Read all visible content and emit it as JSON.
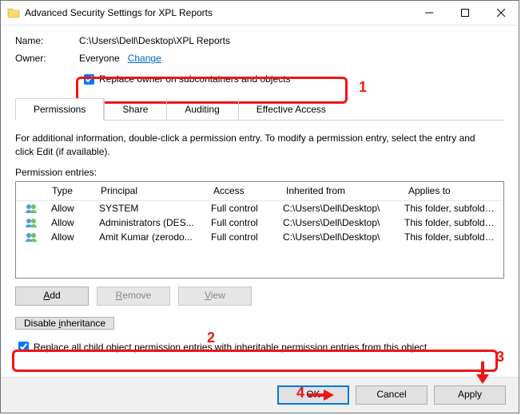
{
  "window": {
    "title": "Advanced Security Settings for XPL Reports"
  },
  "fields": {
    "name_label": "Name:",
    "name_value": "C:\\Users\\Dell\\Desktop\\XPL Reports",
    "owner_label": "Owner:",
    "owner_value": "Everyone",
    "change_link": "Change",
    "replace_owner_label": "Replace owner on subcontainers and objects"
  },
  "tabs": {
    "permissions": "Permissions",
    "share": "Share",
    "auditing": "Auditing",
    "effective": "Effective Access"
  },
  "info_text": "For additional information, double-click a permission entry. To modify a permission entry, select the entry and click Edit (if available).",
  "entries_label": "Permission entries:",
  "columns": {
    "type": "Type",
    "principal": "Principal",
    "access": "Access",
    "inherited": "Inherited from",
    "applies": "Applies to"
  },
  "rows": [
    {
      "type": "Allow",
      "principal": "SYSTEM",
      "access": "Full control",
      "inherited": "C:\\Users\\Dell\\Desktop\\",
      "applies": "This folder, subfolders and files"
    },
    {
      "type": "Allow",
      "principal": "Administrators (DES...",
      "access": "Full control",
      "inherited": "C:\\Users\\Dell\\Desktop\\",
      "applies": "This folder, subfolders and files"
    },
    {
      "type": "Allow",
      "principal": "Amit Kumar  (zerodo...",
      "access": "Full control",
      "inherited": "C:\\Users\\Dell\\Desktop\\",
      "applies": "This folder, subfolders and files"
    }
  ],
  "buttons": {
    "add": "Add",
    "remove": "Remove",
    "view": "View",
    "disable_inheritance": "Disable inheritance",
    "ok": "OK",
    "cancel": "Cancel",
    "apply": "Apply"
  },
  "replace_all_label": "Replace all child object permission entries with inheritable permission entries from this object",
  "callouts": {
    "one": "1",
    "two": "2",
    "three": "3",
    "four": "4"
  }
}
